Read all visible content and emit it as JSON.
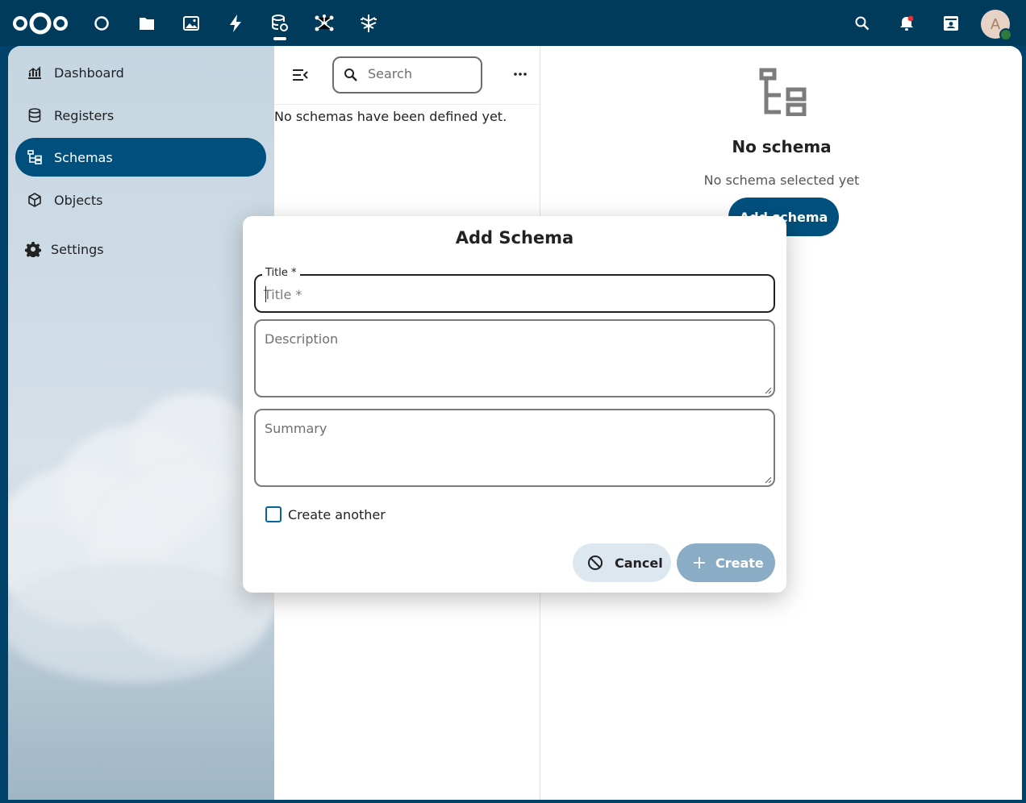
{
  "header": {
    "apps": [
      {
        "name": "dashboard",
        "icon": "circle-icon"
      },
      {
        "name": "files",
        "icon": "folder-icon"
      },
      {
        "name": "photos",
        "icon": "image-icon"
      },
      {
        "name": "activity",
        "icon": "lightning-icon"
      },
      {
        "name": "openregister",
        "icon": "database-icon",
        "active": true
      },
      {
        "name": "network",
        "icon": "hub-icon"
      },
      {
        "name": "tree",
        "icon": "tree-icon"
      }
    ],
    "avatar_initial": "A",
    "right_icons": [
      "search-icon",
      "bell-icon",
      "contacts-icon"
    ]
  },
  "sidebar": {
    "items": [
      {
        "label": "Dashboard",
        "icon": "chart-icon"
      },
      {
        "label": "Registers",
        "icon": "database-icon"
      },
      {
        "label": "Schemas",
        "icon": "schema-icon",
        "active": true
      },
      {
        "label": "Objects",
        "icon": "cube-icon"
      },
      {
        "label": "Settings",
        "icon": "gear-icon"
      }
    ]
  },
  "list": {
    "search_placeholder": "Search",
    "empty_text": "No schemas have been defined yet."
  },
  "detail": {
    "empty_title": "No schema",
    "empty_subtitle": "No schema selected yet",
    "add_button": "Add schema"
  },
  "modal": {
    "title": "Add Schema",
    "title_field_label": "Title *",
    "title_field_placeholder": "Title *",
    "title_field_value": "",
    "description_placeholder": "Description",
    "summary_placeholder": "Summary",
    "create_another_label": "Create another",
    "create_another_checked": false,
    "cancel_label": "Cancel",
    "create_label": "Create"
  },
  "colors": {
    "header_bg": "#003b5c",
    "primary": "#00507e",
    "create_disabled": "#8aadc5",
    "cancel_bg": "#dde7ef"
  }
}
